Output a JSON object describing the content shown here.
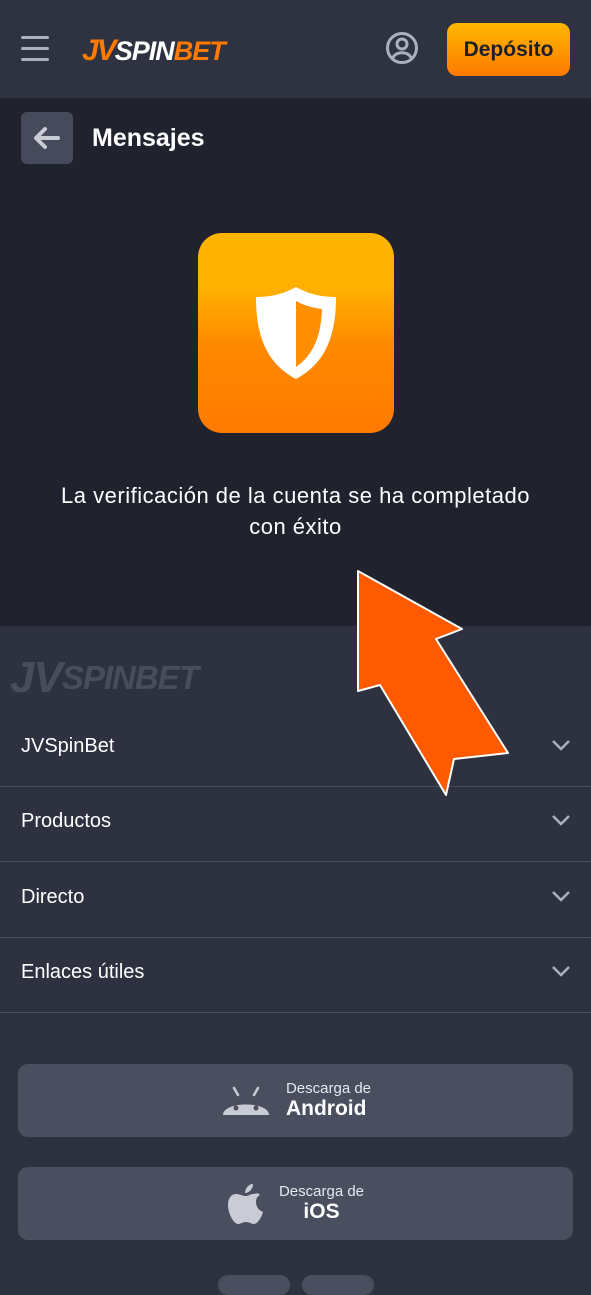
{
  "header": {
    "logo_jv": "JV",
    "logo_spin": "SPIN",
    "logo_bet": "BET",
    "deposit_label": "Depósito",
    "accent_color": "#ff7a00"
  },
  "page": {
    "title": "Mensajes",
    "message": "La verificación de la cuenta se ha completado con éxito"
  },
  "footer": {
    "logo_jv": "JV",
    "logo_text": "SPINBET",
    "sections": [
      {
        "label": "JVSpinBet"
      },
      {
        "label": "Productos"
      },
      {
        "label": "Directo"
      },
      {
        "label": "Enlaces útiles"
      }
    ],
    "downloads": [
      {
        "small": "Descarga de",
        "big": "Android",
        "icon": "android-icon"
      },
      {
        "small": "Descarga de",
        "big": "iOS",
        "icon": "apple-icon"
      }
    ]
  }
}
